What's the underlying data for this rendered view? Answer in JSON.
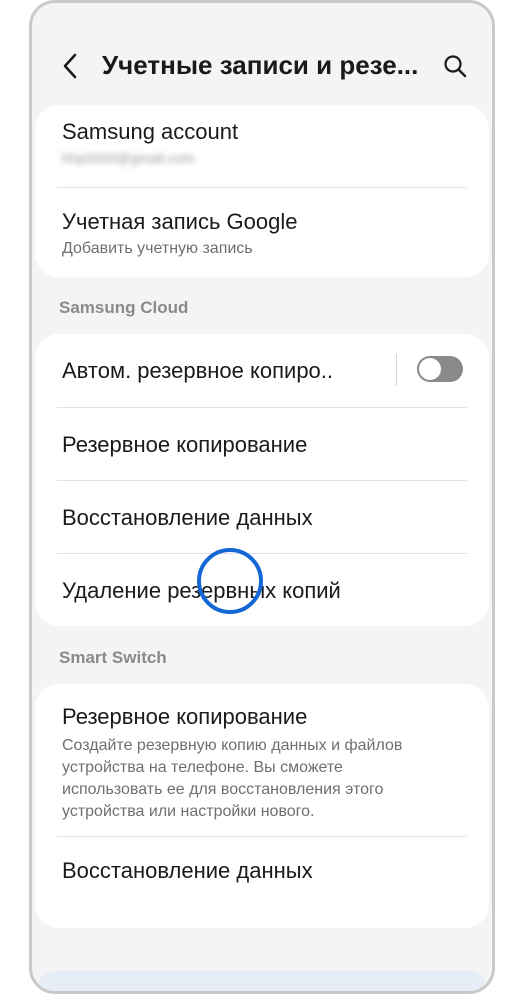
{
  "header": {
    "title": "Учетные записи и резе..."
  },
  "accounts": {
    "samsung_title": "Samsung account",
    "samsung_email": "hhp0000@gmail.com",
    "google_title": "Учетная запись Google",
    "google_sub": "Добавить учетную запись"
  },
  "samsung_cloud": {
    "section_label": "Samsung Cloud",
    "auto_backup_label": "Автом. резервное копиро..",
    "auto_backup_enabled": false,
    "backup_label": "Резервное копирование",
    "restore_label": "Восстановление данных",
    "delete_label": "Удаление резервных копий"
  },
  "smart_switch": {
    "section_label": "Smart Switch",
    "backup_label": "Резервное копирование",
    "backup_desc": "Создайте резервную копию данных и файлов устройства на телефоне. Вы сможете использовать ее для восстановления этого устройства или настройки нового.",
    "restore_label": "Восстановление данных"
  },
  "colors": {
    "highlight_ring": "#1468d6",
    "toggle_off": "#8a8a8a",
    "background": "#f4f4f6"
  }
}
